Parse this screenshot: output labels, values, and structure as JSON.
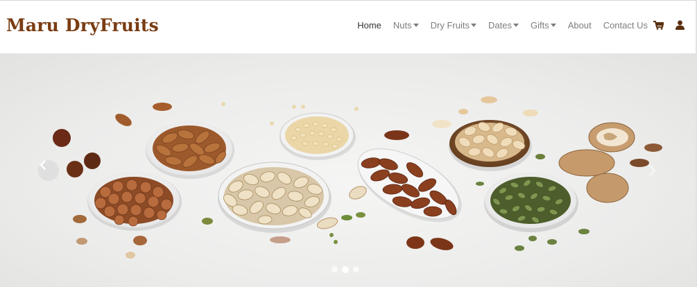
{
  "brand": {
    "name": "Maru DryFruits",
    "color": "#7a3c12"
  },
  "nav": {
    "items": [
      {
        "label": "Home",
        "active": true,
        "dropdown": false
      },
      {
        "label": "Nuts",
        "active": false,
        "dropdown": true
      },
      {
        "label": "Dry Fruits",
        "active": false,
        "dropdown": true
      },
      {
        "label": "Dates",
        "active": false,
        "dropdown": true
      },
      {
        "label": "Gifts",
        "active": false,
        "dropdown": true
      },
      {
        "label": "About",
        "active": false,
        "dropdown": false
      },
      {
        "label": "Contact Us",
        "active": false,
        "dropdown": false
      }
    ],
    "icons": [
      "cart-icon",
      "user-icon"
    ]
  },
  "carousel": {
    "slide_count": 3,
    "active_slide": 2,
    "image": "bowls of mixed nuts and seeds on white marble",
    "controls": [
      "previous-arrow",
      "next-arrow"
    ]
  },
  "colors": {
    "nav_text": "#7d7d7d",
    "nav_active": "#333333",
    "icon": "#5a2e0e"
  }
}
